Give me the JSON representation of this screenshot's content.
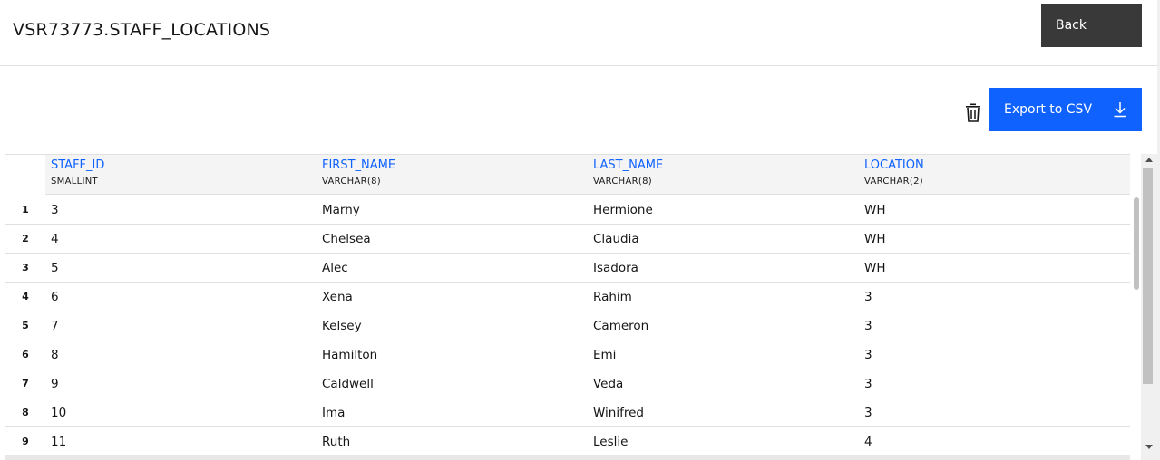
{
  "header": {
    "title": "VSR73773.STAFF_LOCATIONS",
    "back_label": "Back"
  },
  "toolbar": {
    "export_label": "Export to CSV"
  },
  "table": {
    "columns": [
      {
        "name": "STAFF_ID",
        "type": "SMALLINT"
      },
      {
        "name": "FIRST_NAME",
        "type": "VARCHAR(8)"
      },
      {
        "name": "LAST_NAME",
        "type": "VARCHAR(8)"
      },
      {
        "name": "LOCATION",
        "type": "VARCHAR(2)"
      }
    ],
    "rows": [
      {
        "n": "1",
        "cells": [
          "3",
          "Marny",
          "Hermione",
          "WH"
        ]
      },
      {
        "n": "2",
        "cells": [
          "4",
          "Chelsea",
          "Claudia",
          "WH"
        ]
      },
      {
        "n": "3",
        "cells": [
          "5",
          "Alec",
          "Isadora",
          "WH"
        ]
      },
      {
        "n": "4",
        "cells": [
          "6",
          "Xena",
          "Rahim",
          "3"
        ]
      },
      {
        "n": "5",
        "cells": [
          "7",
          "Kelsey",
          "Cameron",
          "3"
        ]
      },
      {
        "n": "6",
        "cells": [
          "8",
          "Hamilton",
          "Emi",
          "3"
        ]
      },
      {
        "n": "7",
        "cells": [
          "9",
          "Caldwell",
          "Veda",
          "3"
        ]
      },
      {
        "n": "8",
        "cells": [
          "10",
          "Ima",
          "Winifred",
          "3"
        ]
      },
      {
        "n": "9",
        "cells": [
          "11",
          "Ruth",
          "Leslie",
          "4"
        ]
      }
    ]
  }
}
